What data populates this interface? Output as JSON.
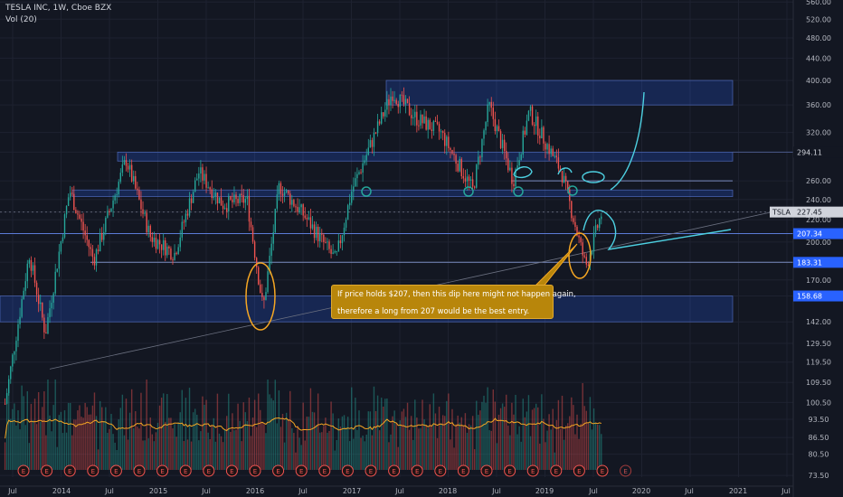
{
  "header": {
    "title": "TESLA INC, 1W, Cboe BZX",
    "volume_label": "Vol (20)"
  },
  "price_axis_ticks": [
    "560.00",
    "520.00",
    "480.00",
    "440.00",
    "400.00",
    "360.00",
    "320.00",
    "294.11",
    "260.00",
    "240.00",
    "227.45",
    "220.00",
    "207.34",
    "200.00",
    "183.31",
    "170.00",
    "158.68",
    "142.00",
    "129.50",
    "119.50",
    "109.50",
    "100.50",
    "93.50",
    "86.50",
    "80.50",
    "73.50"
  ],
  "time_axis_ticks": [
    "Jul",
    "2014",
    "Jul",
    "2015",
    "Jul",
    "2016",
    "Jul",
    "2017",
    "Jul",
    "2018",
    "Jul",
    "2019",
    "Jul",
    "2020",
    "Jul",
    "2021",
    "Jul"
  ],
  "tags": {
    "symbol": "TSLA",
    "current_price": "227.45",
    "level_294": "294.11",
    "level_207": "207.34",
    "level_183": "183.31",
    "level_158": "158.68"
  },
  "annotation": {
    "line1": "If price holds $207, then this dip here might not happen again,",
    "line2": "therefore a long from 207 would be the best entry."
  },
  "earnings_marker": "E",
  "colors": {
    "background": "#131722",
    "up": "#26a69a",
    "down": "#ef5350",
    "zone": "#2962ff",
    "annotation": "#b8860b",
    "drawing": "#4dd0e1",
    "circle_orange": "#f5a623",
    "volume_ma": "#f5a623"
  },
  "chart_data": {
    "type": "candlestick",
    "symbol": "TSLA",
    "interval": "1W",
    "price_scale": "log",
    "ylim": [
      73.5,
      560
    ],
    "x_range": [
      "2013-07",
      "2021-07"
    ],
    "key_levels": [
      294.11,
      260,
      247,
      207.34,
      183.31,
      158.68
    ],
    "zones": [
      [
        360,
        400
      ],
      [
        283,
        294.11
      ],
      [
        243,
        250
      ],
      [
        142,
        158.68
      ]
    ],
    "current_price": 227.45,
    "price_path": [
      {
        "date": "2013-06",
        "price": 100
      },
      {
        "date": "2013-09",
        "price": 190
      },
      {
        "date": "2013-11",
        "price": 135
      },
      {
        "date": "2014-02",
        "price": 250
      },
      {
        "date": "2014-05",
        "price": 185
      },
      {
        "date": "2014-09",
        "price": 285
      },
      {
        "date": "2014-12",
        "price": 205
      },
      {
        "date": "2015-03",
        "price": 190
      },
      {
        "date": "2015-06",
        "price": 270
      },
      {
        "date": "2015-09",
        "price": 235
      },
      {
        "date": "2015-12",
        "price": 240
      },
      {
        "date": "2016-02",
        "price": 150
      },
      {
        "date": "2016-04",
        "price": 255
      },
      {
        "date": "2016-07",
        "price": 225
      },
      {
        "date": "2016-11",
        "price": 185
      },
      {
        "date": "2017-01",
        "price": 250
      },
      {
        "date": "2017-06",
        "price": 380
      },
      {
        "date": "2017-09",
        "price": 340
      },
      {
        "date": "2017-12",
        "price": 320
      },
      {
        "date": "2018-04",
        "price": 250
      },
      {
        "date": "2018-06",
        "price": 360
      },
      {
        "date": "2018-09",
        "price": 260
      },
      {
        "date": "2018-11",
        "price": 350
      },
      {
        "date": "2019-03",
        "price": 270
      },
      {
        "date": "2019-06",
        "price": 180
      },
      {
        "date": "2019-08",
        "price": 227.45
      }
    ]
  }
}
